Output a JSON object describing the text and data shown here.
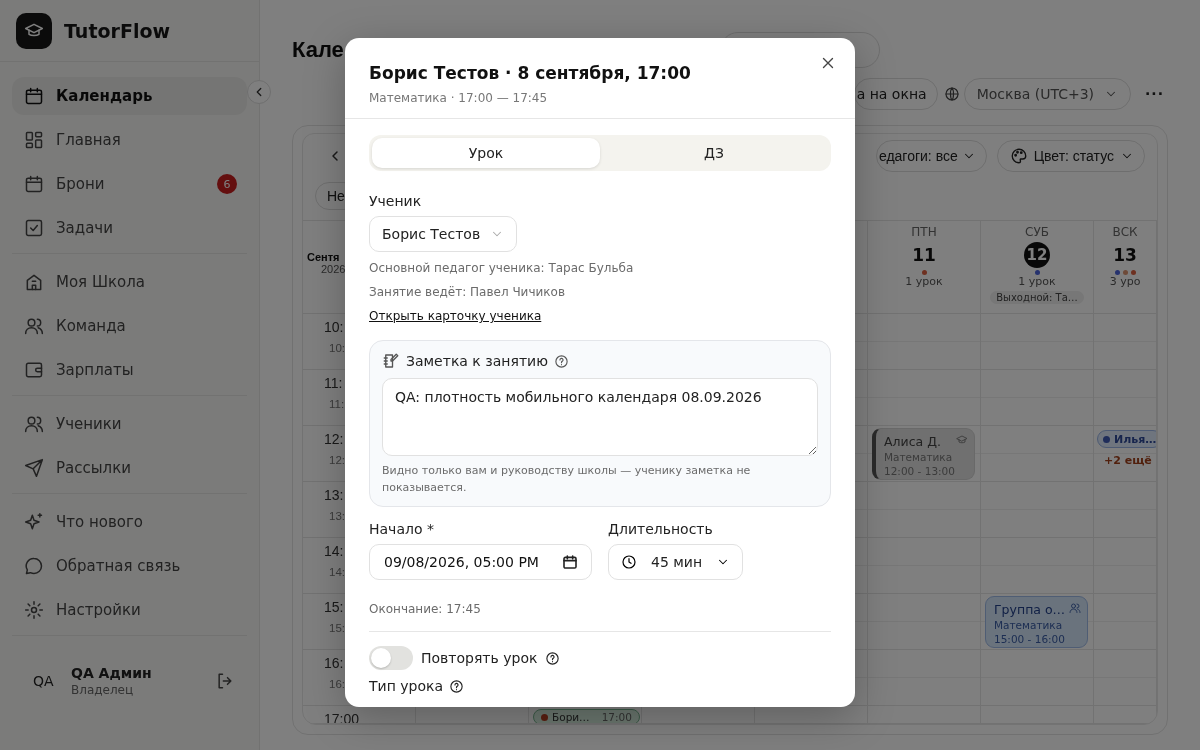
{
  "sidebar": {
    "brand": "TutorFlow",
    "sections": [
      {
        "items": [
          {
            "label": "Календарь",
            "selected": true
          },
          {
            "label": "Главная",
            "selected": false
          },
          {
            "label": "Брони",
            "selected": false,
            "badge": "6"
          },
          {
            "label": "Задачи",
            "selected": false
          }
        ]
      },
      {
        "items": [
          {
            "label": "Моя Школа",
            "selected": false
          },
          {
            "label": "Команда",
            "selected": false
          },
          {
            "label": "Зарплаты",
            "selected": false
          }
        ]
      },
      {
        "items": [
          {
            "label": "Ученики",
            "selected": false
          },
          {
            "label": "Рассылки",
            "selected": false
          }
        ]
      },
      {
        "items": [
          {
            "label": "Что нового",
            "selected": false
          },
          {
            "label": "Обратная связь",
            "selected": false
          },
          {
            "label": "Настройки",
            "selected": false
          }
        ]
      }
    ],
    "user": {
      "initials": "QA",
      "name": "QA Админ",
      "role": "Владелец"
    }
  },
  "page": {
    "title": "Кале",
    "windows_button": "а на окна",
    "timezone": "Москва (UTC+3)",
    "more": "···"
  },
  "calendar": {
    "filters": [
      "едагоги: все",
      "Цвет: статус"
    ],
    "view_chip": "Не",
    "month": "Сентя",
    "year": "2026",
    "days": [
      {
        "weekday": "ПТН",
        "date": "11",
        "today": false,
        "dots": [
          {
            "color": "#6e3020"
          }
        ],
        "count": "1 урок"
      },
      {
        "weekday": "СУБ",
        "date": "12",
        "today": true,
        "dots": [
          {
            "color": "#26326e"
          }
        ],
        "count": "1 урок",
        "note": "Выходной: Та…"
      },
      {
        "weekday": "ВСК",
        "date": "13",
        "today": false,
        "dots": [
          {
            "color": "#26326e"
          },
          {
            "color": "#6e4a38"
          },
          {
            "color": "#6e3020"
          }
        ],
        "count": "3 уро"
      }
    ],
    "hours": [
      {
        "label": "10:",
        "sub": "10:"
      },
      {
        "label": "11:",
        "sub": "11:"
      },
      {
        "label": "12:",
        "sub": "12:",
        "cells": [
          {},
          {},
          {},
          {},
          {
            "events": [
              {
                "kind": "card",
                "title": "Алиса Д.",
                "subject": "Математика",
                "time": "12:00 - 13:00",
                "color": "#707070"
              }
            ]
          },
          {},
          {
            "events": [
              {
                "kind": "chip",
                "title": "Илья…",
                "color": "#1f2d5a"
              }
            ],
            "more": "+2 ещё"
          }
        ]
      },
      {
        "label": "13:",
        "sub": "13:"
      },
      {
        "label": "14:",
        "sub": "14:"
      },
      {
        "label": "15:",
        "sub": "15:",
        "cells": [
          {},
          {},
          {},
          {},
          {},
          {
            "events": [
              {
                "kind": "group",
                "title": "Группа о…",
                "subject": "Математика",
                "time": "15:00 - 16:00",
                "color": "#6a737d"
              }
            ]
          }
        ]
      },
      {
        "label": "16:",
        "sub": "16:"
      },
      {
        "label": "17:00",
        "cells": [
          {},
          {
            "events": [
              {
                "kind": "chip",
                "title": "Бори…",
                "time": "17:00",
                "color": "#5a1f12"
              }
            ]
          }
        ]
      }
    ]
  },
  "modal": {
    "title": "Борис Тестов · 8 сентября, 17:00",
    "subtitle": "Математика · 17:00 — 17:45",
    "tabs": [
      {
        "label": "Урок",
        "selected": true
      },
      {
        "label": "ДЗ",
        "selected": false
      }
    ],
    "student": {
      "label": "Ученик",
      "value": "Борис Тестов"
    },
    "info": [
      "Основной педагог ученика: Тарас Бульба",
      "Занятие ведёт: Павел Чичиков"
    ],
    "link": "Открыть карточку ученика",
    "note": {
      "title": "Заметка к занятию",
      "value": "QA: плотность мобильного календаря 08.09.2026",
      "hint": "Видно только вам и руководству школы — ученику заметка не показывается."
    },
    "start": {
      "label": "Начало *",
      "value": "09/08/2026, 05:00 PM"
    },
    "duration": {
      "label": "Длительность",
      "value": "45 мин"
    },
    "end": "Окончание: 17:45",
    "repeat": {
      "label": "Повторять урок",
      "on": false
    },
    "type_label": "Тип урока"
  }
}
